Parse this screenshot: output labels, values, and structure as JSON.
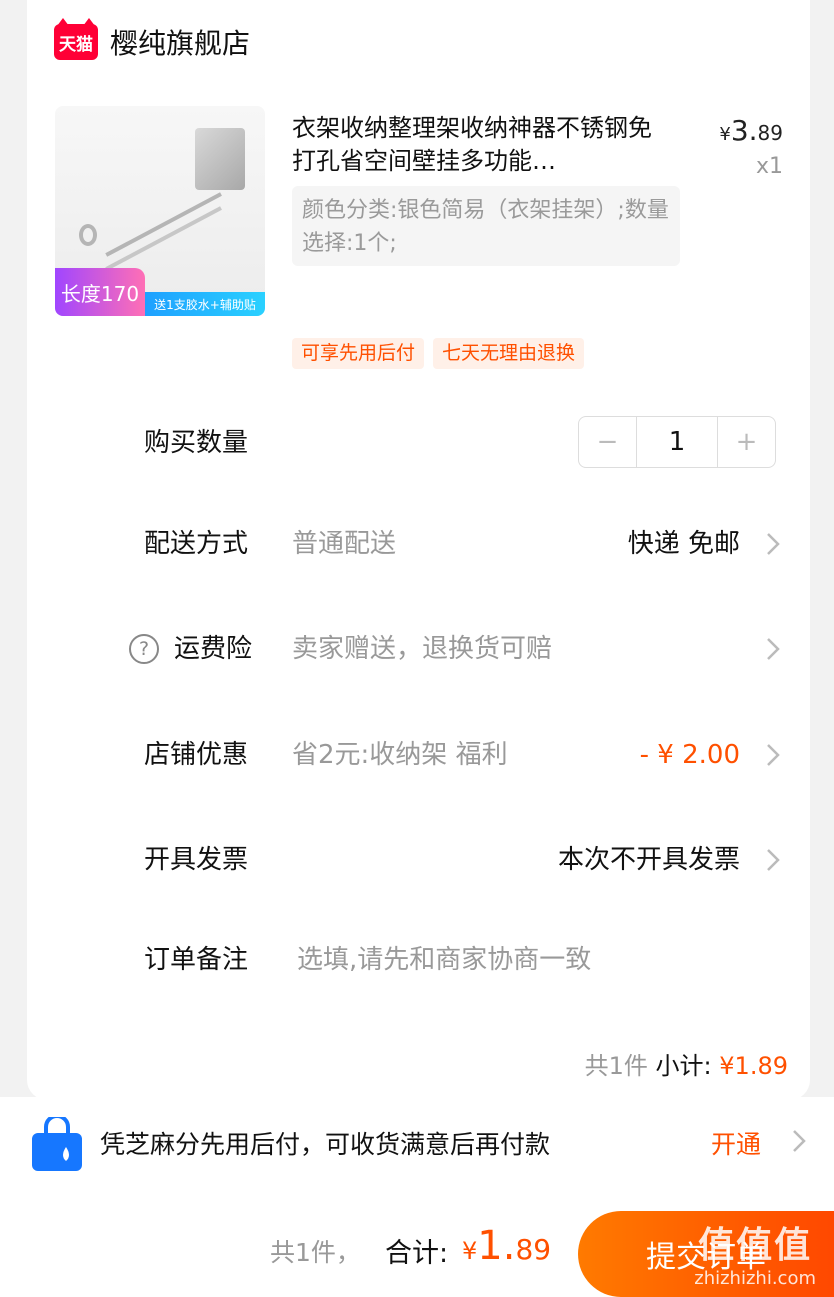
{
  "shop": {
    "badge": "天猫",
    "name": "樱纯旗舰店"
  },
  "product": {
    "image_tag": "长度170",
    "image_gift": "送1支胶水+辅助贴",
    "title": "衣架收纳整理架收纳神器不锈钢免打孔省空间壁挂多功能…",
    "price_symbol": "¥",
    "price_int": "3.",
    "price_dec": "89",
    "quantity_x": "x1",
    "sku": "颜色分类:银色简易（衣架挂架）;数量选择:1个;",
    "tags": [
      "可享先用后付",
      "七天无理由退换"
    ]
  },
  "rows": {
    "quantity": {
      "label": "购买数量",
      "value": "1",
      "minus": "−",
      "plus": "+"
    },
    "delivery": {
      "label": "配送方式",
      "sub": "普通配送",
      "value": "快递 免邮"
    },
    "insurance": {
      "label": "运费险",
      "help": "?",
      "sub": "卖家赠送，退换货可赔"
    },
    "discount": {
      "label": "店铺优惠",
      "sub": "省2元:收纳架 福利",
      "value": "- ¥ 2.00"
    },
    "invoice": {
      "label": "开具发票",
      "value": "本次不开具发票"
    },
    "note": {
      "label": "订单备注",
      "placeholder": "选填,请先和商家协商一致"
    }
  },
  "subtotal": {
    "count": "共1件",
    "label": "小计:",
    "amount": "¥1.89"
  },
  "promo": {
    "text": "凭芝麻分先用后付，可收货满意后再付款",
    "action": "开通"
  },
  "bottom": {
    "count": "共1件，",
    "total_label": "合计:",
    "total_symbol": "¥",
    "total_int": "1.",
    "total_dec": "89",
    "submit": "提交订单"
  },
  "watermark": {
    "big": "值值值",
    "small": "zhizhizhi.com"
  },
  "colors": {
    "accent": "#ff5000",
    "tmall": "#ff0036"
  }
}
